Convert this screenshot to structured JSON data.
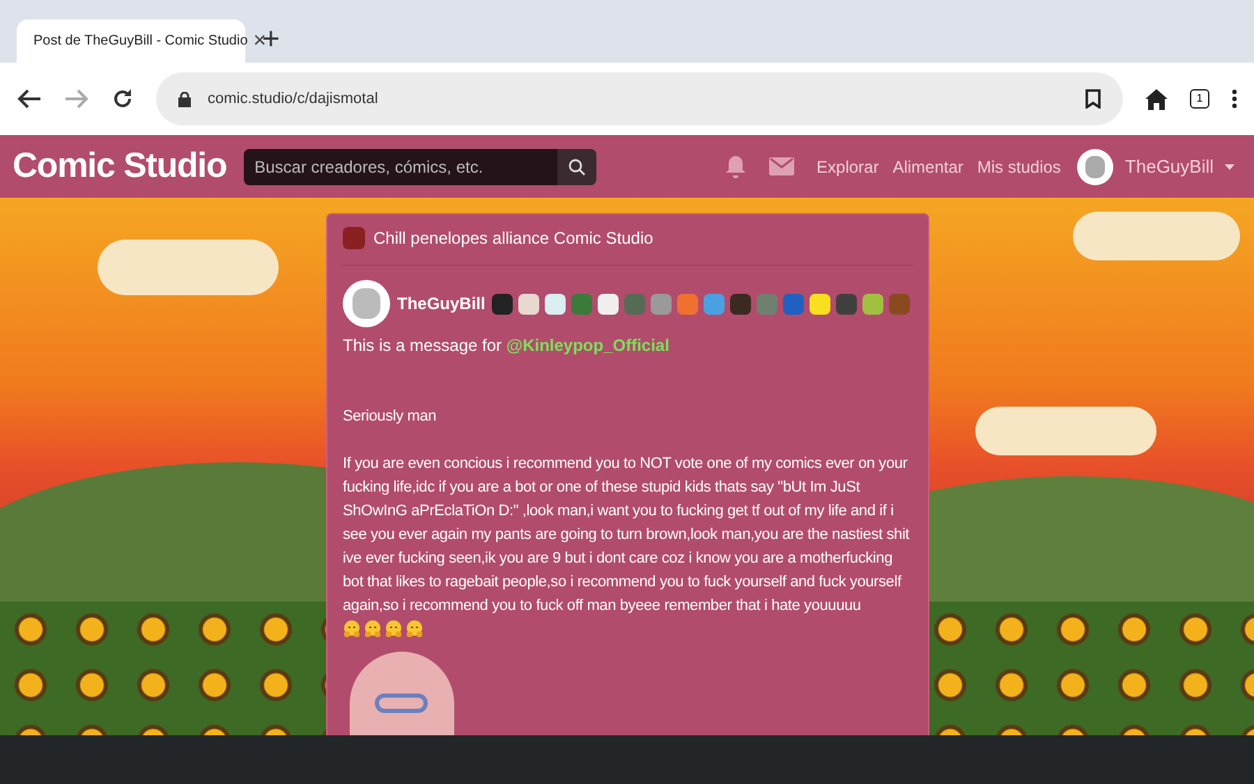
{
  "browser": {
    "tab_title": "Post de TheGuyBill - Comic Studio",
    "tab_close": "×",
    "new_tab": "+",
    "url": "comic.studio/c/dajismotal",
    "tab_count": "1"
  },
  "site_nav": {
    "logo": "Comic Studio",
    "search": {
      "placeholder": "Buscar creadores, cómics, etc."
    },
    "links": [
      "Explorar",
      "Alimentar",
      "Mis studios"
    ],
    "username": "TheGuyBill"
  },
  "post": {
    "studio": "Chill penelopes alliance Comic Studio",
    "author": "TheGuyBill",
    "badges": [
      {
        "color": "#222222"
      },
      {
        "color": "#e8d8d0"
      },
      {
        "color": "#d8eef0"
      },
      {
        "color": "#3a7a3a"
      },
      {
        "color": "#f0f0f0"
      },
      {
        "color": "#556b55"
      },
      {
        "color": "#9a9a9a"
      },
      {
        "color": "#f07030"
      },
      {
        "color": "#4aa0e0"
      },
      {
        "color": "#3a2a20"
      },
      {
        "color": "#708070"
      },
      {
        "color": "#2060c0"
      },
      {
        "color": "#f8e020"
      },
      {
        "color": "#404040"
      },
      {
        "color": "#a0c040"
      },
      {
        "color": "#8a4a20"
      }
    ],
    "intro": "This is a message for",
    "mention": "@Kinleypop_Official",
    "paragraphs": [
      "Seriously man",
      "If you are even concious i recommend you to NOT vote one of my comics ever on your fucking life,idc if you are a bot or one of these stupid kids thats say \"bUt Im JuSt ShOwInG aPrEclaTiOn D:\" ,look man,i want you to fucking get tf out of my life and if i see you ever again my pants are going to turn brown,look man,you are the nastiest shit ive ever fucking seen,ik you are 9 but i dont care coz i know you are a motherfucking bot that likes to ragebait people,so i recommend you to fuck yourself and fuck yourself again,so i recommend you to fuck off man byeee remember that i hate youuuuu"
    ],
    "emoji": [
      {
        "kind": "hug"
      },
      {
        "kind": "hug"
      },
      {
        "kind": "hug"
      },
      {
        "kind": "hug"
      }
    ]
  }
}
